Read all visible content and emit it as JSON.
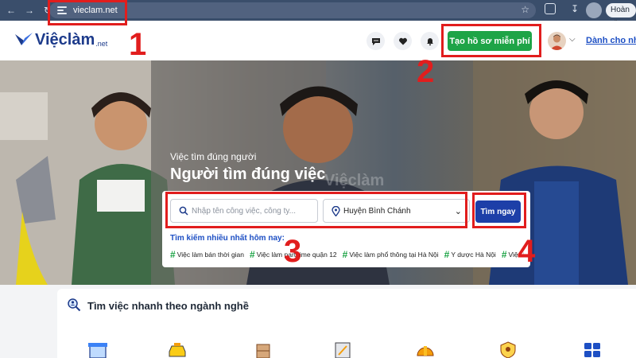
{
  "browser": {
    "url": "vieclam.net",
    "done_label": "Hoàn tất"
  },
  "header": {
    "logo_text": "Việclàm",
    "logo_suffix": ".net",
    "create_profile_label": "Tạo hồ sơ miễn phí",
    "employer_link": "Dành cho nhà"
  },
  "hero": {
    "tagline": "Việc tìm đúng người",
    "headline": "Người tìm đúng việc",
    "watermark": "Việclàm"
  },
  "search": {
    "keyword_placeholder": "Nhập tên công việc, công ty...",
    "location_value": "Huyện Bình Chánh",
    "submit_label": "Tìm ngay",
    "trending_label": "Tìm kiếm nhiều nhất hôm nay:",
    "trending": [
      "Việc làm bán thời gian",
      "Việc làm part time quận 12",
      "Việc làm phổ thông tại Hà Nội",
      "Y dược Hà Nội",
      "Việc làm"
    ]
  },
  "annotations": [
    "1",
    "2",
    "3",
    "4"
  ],
  "categories": {
    "title": "Tìm việc nhanh theo ngành nghề"
  },
  "colors": {
    "brand_blue": "#1d3b8b",
    "cta_green": "#1ea447",
    "annotation_red": "#e11d1d"
  }
}
